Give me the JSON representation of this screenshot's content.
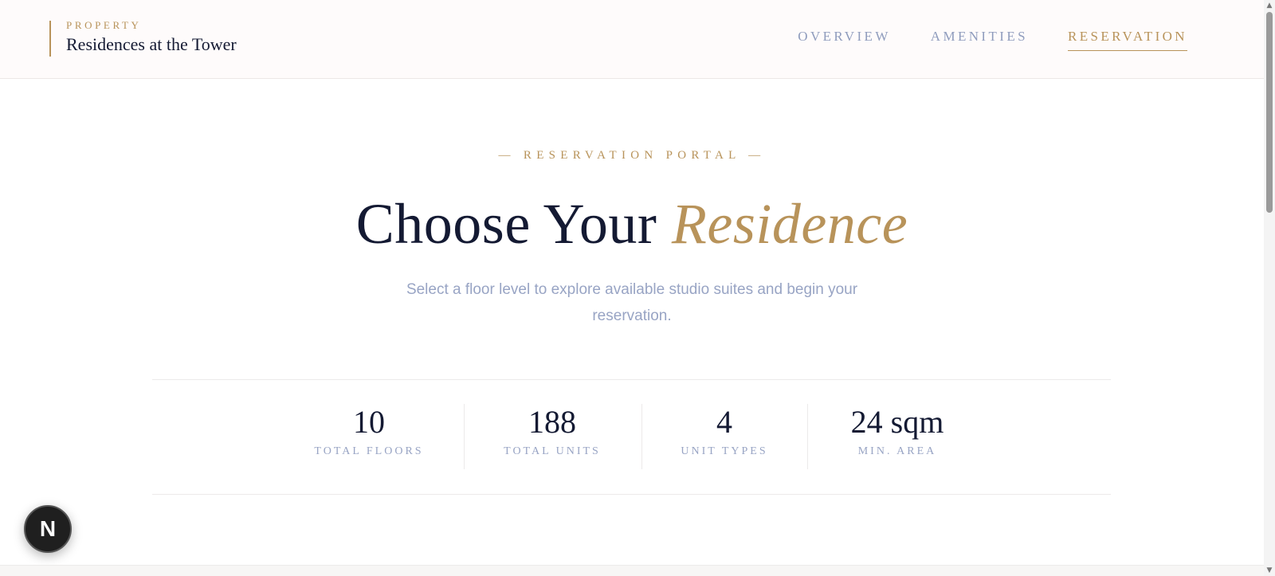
{
  "header": {
    "kicker": "PROPERTY",
    "title": "Residences at the Tower",
    "nav": [
      {
        "label": "OVERVIEW",
        "active": false
      },
      {
        "label": "AMENITIES",
        "active": false
      },
      {
        "label": "RESERVATION",
        "active": true
      }
    ]
  },
  "hero": {
    "kicker": "— RESERVATION PORTAL —",
    "headline_main": "Choose Your",
    "headline_accent": "Residence",
    "subtitle": "Select a floor level to explore available studio suites and begin your reservation."
  },
  "stats": [
    {
      "value": "10",
      "label": "TOTAL FLOORS"
    },
    {
      "value": "188",
      "label": "TOTAL UNITS"
    },
    {
      "value": "4",
      "label": "UNIT TYPES"
    },
    {
      "value": "24 sqm",
      "label": "MIN. AREA"
    }
  ],
  "badge": {
    "letter": "N"
  },
  "colors": {
    "accent": "#b8935a",
    "ink": "#141a33",
    "muted": "#98a4c4",
    "nav_muted": "#8f9cbd"
  },
  "icons": {
    "scroll_up": "triangle-up-icon",
    "scroll_down": "triangle-down-icon"
  }
}
